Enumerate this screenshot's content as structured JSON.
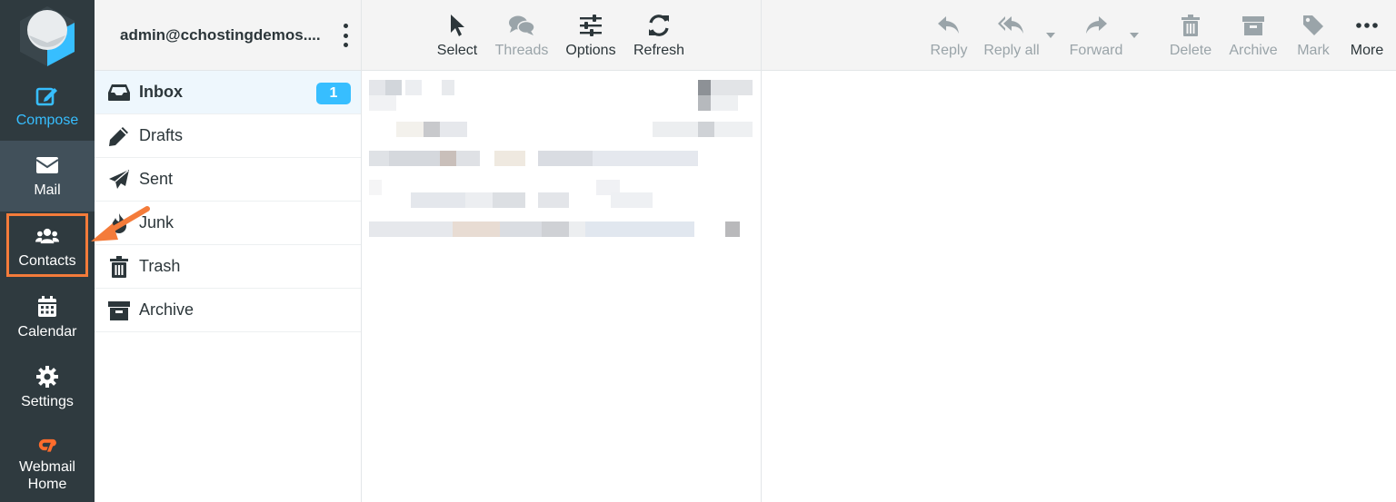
{
  "rail": {
    "items": [
      {
        "label": "Compose",
        "icon": "compose-icon"
      },
      {
        "label": "Mail",
        "icon": "envelope-icon"
      },
      {
        "label": "Contacts",
        "icon": "users-icon"
      },
      {
        "label": "Calendar",
        "icon": "calendar-icon"
      },
      {
        "label": "Settings",
        "icon": "gear-icon"
      },
      {
        "label": "Webmail",
        "label2": "Home",
        "icon": "cpanel-icon"
      }
    ],
    "colors": {
      "background": "#2f3a3f",
      "active": "#41505a",
      "compose": "#37beff",
      "highlight": "#f47b3a"
    }
  },
  "account": {
    "email": "admin@cchostingdemos...."
  },
  "folders": [
    {
      "label": "Inbox",
      "icon": "inbox-icon",
      "unread": "1"
    },
    {
      "label": "Drafts",
      "icon": "pencil-icon"
    },
    {
      "label": "Sent",
      "icon": "paper-plane-icon"
    },
    {
      "label": "Junk",
      "icon": "fire-icon"
    },
    {
      "label": "Trash",
      "icon": "trash-icon"
    },
    {
      "label": "Archive",
      "icon": "archive-box-icon"
    }
  ],
  "list_toolbar": {
    "buttons": [
      {
        "label": "Select",
        "icon": "pointer-icon",
        "enabled": true
      },
      {
        "label": "Threads",
        "icon": "comments-icon",
        "enabled": false
      },
      {
        "label": "Options",
        "icon": "sliders-icon",
        "enabled": true
      },
      {
        "label": "Refresh",
        "icon": "refresh-icon",
        "enabled": true
      }
    ]
  },
  "reader_toolbar": {
    "buttons": [
      {
        "label": "Reply",
        "icon": "reply-icon",
        "enabled": false
      },
      {
        "label": "Reply all",
        "icon": "reply-all-icon",
        "enabled": false,
        "dropdown": true
      },
      {
        "label": "Forward",
        "icon": "forward-icon",
        "enabled": false,
        "dropdown": true
      },
      {
        "label": "Delete",
        "icon": "trash-icon",
        "enabled": false
      },
      {
        "label": "Archive",
        "icon": "archive-box-icon",
        "enabled": false
      },
      {
        "label": "Mark",
        "icon": "tag-icon",
        "enabled": false
      },
      {
        "label": "More",
        "icon": "more-dots-icon",
        "enabled": true
      }
    ]
  }
}
